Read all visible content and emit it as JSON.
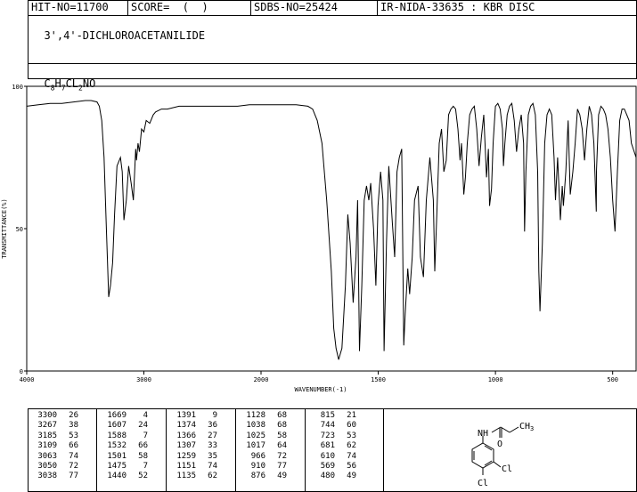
{
  "header": {
    "hit_no": "HIT-NO=11700",
    "score": "SCORE=  (  )",
    "sdbs_no": "SDBS-NO=25424",
    "method": "IR-NIDA-33635 : KBR DISC",
    "compound": "3',4'-DICHLOROACETANILIDE",
    "formula_parts": [
      "C",
      "8",
      "H",
      "7",
      "CL",
      "2",
      "NO"
    ]
  },
  "chart_data": {
    "type": "line",
    "title": "",
    "xlabel": "WAVENUMBER(-1)",
    "ylabel": "TRANSMITTANCE(%)",
    "xlim": [
      4000,
      400
    ],
    "ylim": [
      0,
      100
    ],
    "x_ticks": [
      4000,
      3000,
      2000,
      1500,
      1000,
      500
    ],
    "y_ticks": [
      0,
      50,
      100
    ],
    "grid": false,
    "series": [
      {
        "x": [
          4000,
          3900,
          3800,
          3700,
          3600,
          3500,
          3450,
          3400,
          3380,
          3360,
          3340,
          3320,
          3300,
          3285,
          3267,
          3250,
          3230,
          3200,
          3185,
          3170,
          3150,
          3130,
          3109,
          3090,
          3070,
          3063,
          3050,
          3038,
          3020,
          3000,
          2980,
          2950,
          2920,
          2900,
          2850,
          2800,
          2700,
          2600,
          2500,
          2400,
          2300,
          2200,
          2100,
          2000,
          1950,
          1900,
          1850,
          1800,
          1780,
          1760,
          1740,
          1720,
          1700,
          1690,
          1680,
          1669,
          1655,
          1640,
          1630,
          1620,
          1607,
          1595,
          1588,
          1580,
          1570,
          1560,
          1550,
          1540,
          1532,
          1520,
          1510,
          1501,
          1490,
          1480,
          1475,
          1465,
          1455,
          1440,
          1430,
          1420,
          1410,
          1400,
          1391,
          1385,
          1374,
          1366,
          1355,
          1345,
          1330,
          1320,
          1307,
          1295,
          1280,
          1265,
          1259,
          1250,
          1240,
          1230,
          1220,
          1210,
          1200,
          1190,
          1180,
          1170,
          1160,
          1151,
          1145,
          1135,
          1128,
          1120,
          1110,
          1100,
          1090,
          1080,
          1070,
          1060,
          1050,
          1038,
          1030,
          1025,
          1017,
          1010,
          1000,
          990,
          980,
          970,
          966,
          960,
          950,
          940,
          930,
          920,
          910,
          900,
          890,
          880,
          876,
          870,
          860,
          850,
          840,
          830,
          820,
          815,
          810,
          800,
          790,
          780,
          770,
          760,
          750,
          744,
          735,
          723,
          715,
          710,
          700,
          690,
          681,
          670,
          660,
          650,
          640,
          630,
          620,
          610,
          600,
          590,
          580,
          570,
          569,
          560,
          550,
          540,
          530,
          520,
          510,
          500,
          490,
          480,
          470,
          460,
          450,
          440,
          430,
          420,
          400
        ],
        "y": [
          93,
          93.5,
          94,
          94,
          94.5,
          95,
          95,
          94.5,
          93,
          88,
          75,
          50,
          26,
          30,
          38,
          55,
          72,
          75,
          70,
          53,
          60,
          72,
          66,
          60,
          78,
          74,
          80,
          77,
          85,
          84,
          88,
          87,
          90,
          91,
          92,
          92,
          93,
          93,
          93,
          93,
          93,
          93,
          93.5,
          93.5,
          93.5,
          93.5,
          93.5,
          93,
          92,
          88,
          80,
          60,
          35,
          15,
          8,
          4,
          8,
          30,
          55,
          45,
          24,
          40,
          60,
          7,
          30,
          60,
          65,
          60,
          66,
          50,
          30,
          58,
          70,
          60,
          7,
          45,
          72,
          52,
          40,
          70,
          75,
          78,
          9,
          20,
          36,
          27,
          40,
          60,
          65,
          40,
          33,
          60,
          75,
          60,
          35,
          55,
          80,
          85,
          70,
          74,
          90,
          92,
          93,
          92,
          85,
          74,
          80,
          62,
          68,
          80,
          90,
          92,
          93,
          85,
          72,
          82,
          90,
          68,
          78,
          58,
          64,
          80,
          93,
          94,
          92,
          85,
          72,
          80,
          90,
          93,
          94,
          88,
          77,
          85,
          90,
          80,
          49,
          70,
          90,
          93,
          94,
          90,
          70,
          35,
          21,
          45,
          80,
          90,
          92,
          90,
          75,
          60,
          75,
          53,
          65,
          58,
          70,
          88,
          62,
          70,
          80,
          92,
          90,
          85,
          74,
          85,
          93,
          90,
          80,
          56,
          70,
          90,
          93,
          92,
          90,
          85,
          75,
          60,
          49,
          70,
          88,
          92,
          92,
          90,
          88,
          80,
          75
        ]
      }
    ]
  },
  "peak_table": [
    [
      [
        "3300",
        "26"
      ],
      [
        "3267",
        "38"
      ],
      [
        "3185",
        "53"
      ],
      [
        "3109",
        "66"
      ],
      [
        "3063",
        "74"
      ],
      [
        "3050",
        "72"
      ],
      [
        "3038",
        "77"
      ]
    ],
    [
      [
        "1669",
        "4"
      ],
      [
        "1607",
        "24"
      ],
      [
        "1588",
        "7"
      ],
      [
        "1532",
        "66"
      ],
      [
        "1501",
        "58"
      ],
      [
        "1475",
        "7"
      ],
      [
        "1440",
        "52"
      ]
    ],
    [
      [
        "1391",
        "9"
      ],
      [
        "1374",
        "36"
      ],
      [
        "1366",
        "27"
      ],
      [
        "1307",
        "33"
      ],
      [
        "1259",
        "35"
      ],
      [
        "1151",
        "74"
      ],
      [
        "1135",
        "62"
      ]
    ],
    [
      [
        "1128",
        "68"
      ],
      [
        "1038",
        "68"
      ],
      [
        "1025",
        "58"
      ],
      [
        "1017",
        "64"
      ],
      [
        "966",
        "72"
      ],
      [
        "910",
        "77"
      ],
      [
        "876",
        "49"
      ]
    ],
    [
      [
        "815",
        "21"
      ],
      [
        "744",
        "60"
      ],
      [
        "723",
        "53"
      ],
      [
        "681",
        "62"
      ],
      [
        "610",
        "74"
      ],
      [
        "569",
        "56"
      ],
      [
        "480",
        "49"
      ]
    ]
  ],
  "structure": {
    "nh_label": "NH",
    "ch3_label": "CH",
    "ch3_sub": "3",
    "o_label": "O",
    "cl1_label": "Cl",
    "cl2_label": "Cl"
  }
}
